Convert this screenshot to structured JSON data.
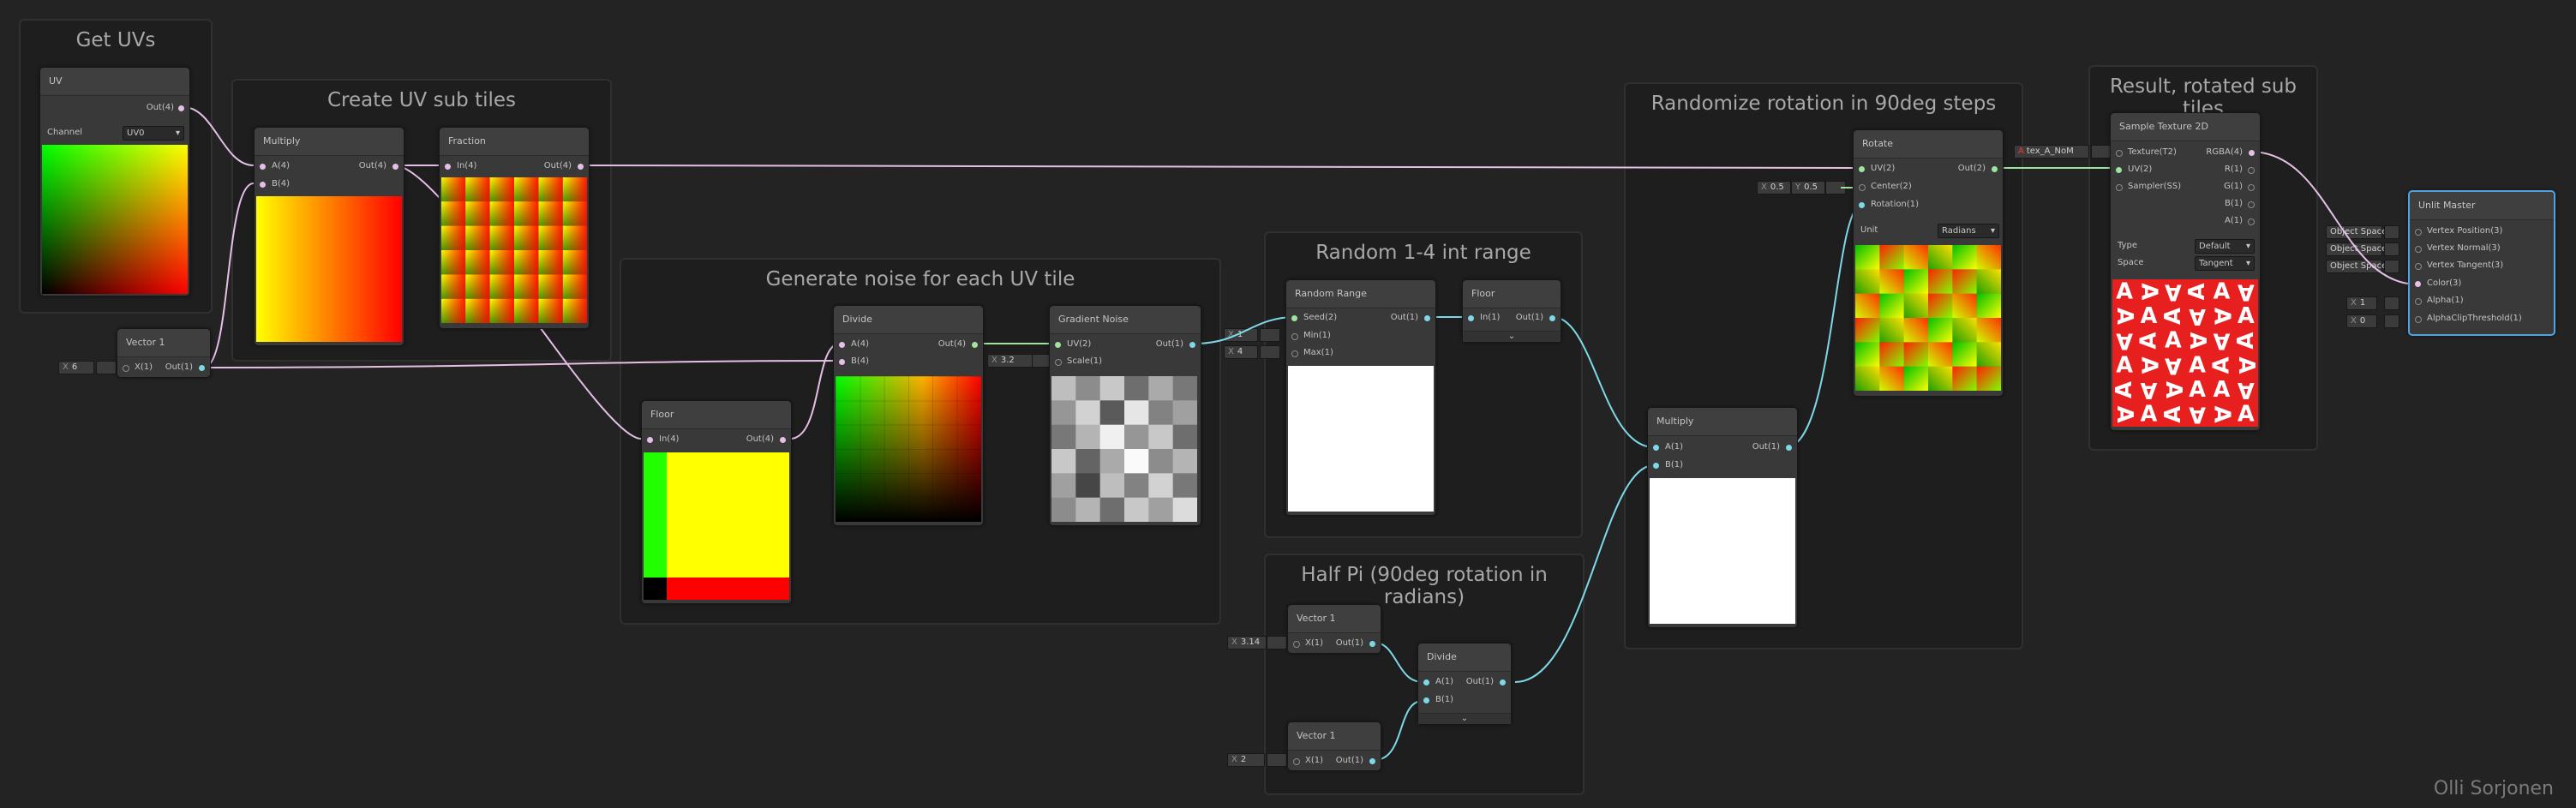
{
  "groups": {
    "get_uvs": "Get UVs",
    "create_sub_tiles": "Create UV sub tiles",
    "generate_noise": "Generate noise for each UV tile",
    "random_range": "Random 1-4 int range",
    "half_pi": "Half Pi (90deg rotation in radians)",
    "randomize_rotation": "Randomize rotation in 90deg steps",
    "result": "Result, rotated sub tiles"
  },
  "nodes": {
    "uv": {
      "title": "UV",
      "out": "Out(4)",
      "channel_label": "Channel",
      "channel_value": "UV0"
    },
    "vector1_a": {
      "title": "Vector 1",
      "x_label": "X(1)",
      "out": "Out(1)",
      "input_axis": "X",
      "input_value": "6"
    },
    "multiply_a": {
      "title": "Multiply",
      "in_a": "A(4)",
      "in_b": "B(4)",
      "out": "Out(4)"
    },
    "fraction": {
      "title": "Fraction",
      "in": "In(4)",
      "out": "Out(4)"
    },
    "floor_a": {
      "title": "Floor",
      "in": "In(4)",
      "out": "Out(4)"
    },
    "divide_a": {
      "title": "Divide",
      "in_a": "A(4)",
      "in_b": "B(4)",
      "out": "Out(4)"
    },
    "gradient_noise": {
      "title": "Gradient Noise",
      "uv": "UV(2)",
      "scale": "Scale(1)",
      "out": "Out(1)",
      "scale_axis": "X",
      "scale_value": "3.2"
    },
    "random_range": {
      "title": "Random Range",
      "seed": "Seed(2)",
      "min": "Min(1)",
      "max": "Max(1)",
      "out": "Out(1)",
      "min_axis": "X",
      "min_value": "1",
      "max_axis": "X",
      "max_value": "4"
    },
    "floor_b": {
      "title": "Floor",
      "in": "In(1)",
      "out": "Out(1)"
    },
    "vector1_b": {
      "title": "Vector 1",
      "x_label": "X(1)",
      "out": "Out(1)",
      "input_axis": "X",
      "input_value": "3.14"
    },
    "divide_b": {
      "title": "Divide",
      "in_a": "A(1)",
      "in_b": "B(1)",
      "out": "Out(1)"
    },
    "vector1_c": {
      "title": "Vector 1",
      "x_label": "X(1)",
      "out": "Out(1)",
      "input_axis": "X",
      "input_value": "2"
    },
    "multiply_b": {
      "title": "Multiply",
      "in_a": "A(1)",
      "in_b": "B(1)",
      "out": "Out(1)"
    },
    "rotate": {
      "title": "Rotate",
      "uv": "UV(2)",
      "center": "Center(2)",
      "rotation": "Rotation(1)",
      "out": "Out(2)",
      "unit_label": "Unit",
      "unit_value": "Radians",
      "center_x_axis": "X",
      "center_x": "0.5",
      "center_y_axis": "Y",
      "center_y": "0.5"
    },
    "sample_texture": {
      "title": "Sample Texture 2D",
      "texture": "Texture(T2)",
      "uv": "UV(2)",
      "sampler": "Sampler(SS)",
      "rgba": "RGBA(4)",
      "r": "R(1)",
      "g": "G(1)",
      "b": "B(1)",
      "a": "A(1)",
      "type_label": "Type",
      "type_value": "Default",
      "space_label": "Space",
      "space_value": "Tangent",
      "texture_input": "tex_A_NoM",
      "texture_glyph": "A"
    },
    "unlit_master": {
      "title": "Unlit Master",
      "vertex_position": "Vertex Position(3)",
      "vertex_normal": "Vertex Normal(3)",
      "vertex_tangent": "Vertex Tangent(3)",
      "color": "Color(3)",
      "alpha": "Alpha(1)",
      "alpha_clip": "AlphaClipThreshold(1)",
      "space_1": "Object Space",
      "space_2": "Object Space",
      "space_3": "Object Space",
      "alpha_axis": "X",
      "alpha_value": "1",
      "clip_axis": "X",
      "clip_value": "0"
    }
  },
  "watermark": "Olli Sorjonen",
  "colors": {
    "background": "#232323",
    "group": "#1e1e1e",
    "node": "#393939",
    "wire_pink": "#e6bfe6",
    "wire_green": "#9ee49e",
    "wire_cyan": "#7ed8e8",
    "selection": "#4fa3e0"
  }
}
